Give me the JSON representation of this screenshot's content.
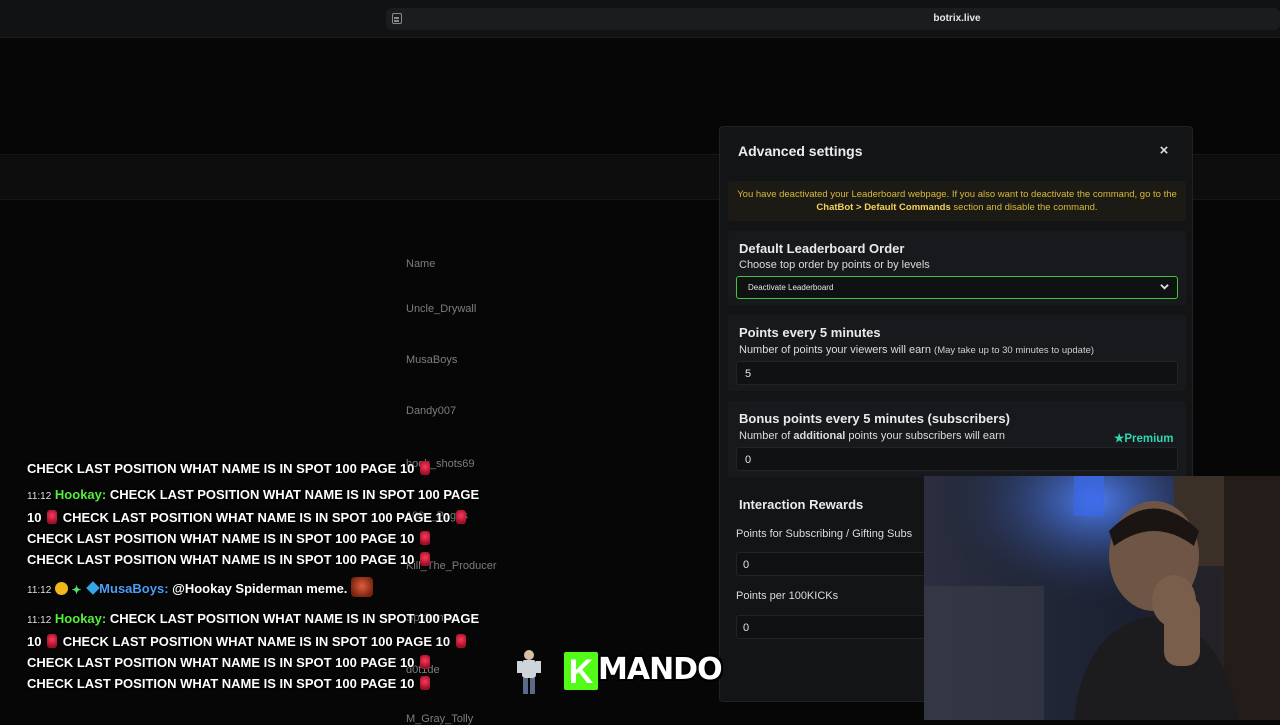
{
  "browser": {
    "url": "botrix.live"
  },
  "leaderboard": {
    "column_header": "Name",
    "rows": [
      "Uncle_Drywall",
      "MusaBoys",
      "Dandy007",
      "hook_shots69",
      "100__Pages",
      "Kill_The_Producer",
      "Spiderman",
      "d0t1de",
      "M_Gray_Tolly"
    ]
  },
  "modal": {
    "title": "Advanced settings",
    "close_label": "×",
    "notice": {
      "part1": "You have deactivated your Leaderboard webpage. If you also want to deactivate the command, go to the ",
      "chatbot": "ChatBot",
      "sep": " > ",
      "default_commands": "Default Commands",
      "part2": " section and disable the command."
    },
    "leaderboard_order": {
      "title": "Default Leaderboard Order",
      "description": "Choose top order by points or by levels",
      "selected": "Deactivate Leaderboard"
    },
    "points_every": {
      "title": "Points every 5 minutes",
      "description": "Number of points your viewers will earn",
      "note": "(May take up to 30 minutes to update)",
      "value": "5"
    },
    "bonus_points": {
      "title": "Bonus points every 5 minutes (subscribers)",
      "desc_before": "Number of ",
      "desc_bold": "additional",
      "desc_after": " points your subscribers will earn",
      "premium_label": "Premium",
      "value": "0"
    },
    "interaction_rewards": {
      "title": "Interaction Rewards",
      "subscribing_label": "Points for Subscribing / Gifting Subs",
      "subscribing_value": "0",
      "kicks_label": "Points per 100KICKs",
      "kicks_value": "0"
    }
  },
  "chat": {
    "message_text": "CHECK LAST POSITION WHAT NAME IS IN SPOT 100 PAGE 10",
    "message_text_wrap_a": "CHECK LAST POSITION WHAT NAME IS IN SPOT 100 PAGE",
    "message_text_wrap_b": "10",
    "time": "11:12",
    "user1": "Hookay",
    "user2": "MusaBoys",
    "reply": "@Hookay Spiderman meme.",
    "colon": ":"
  },
  "overlay": {
    "logo_letter": "K",
    "logo_text": "MANDO"
  },
  "colors": {
    "accent_green": "#53fc18",
    "premium_teal": "#2fd6b0",
    "notice_gold": "#d8b93b"
  }
}
